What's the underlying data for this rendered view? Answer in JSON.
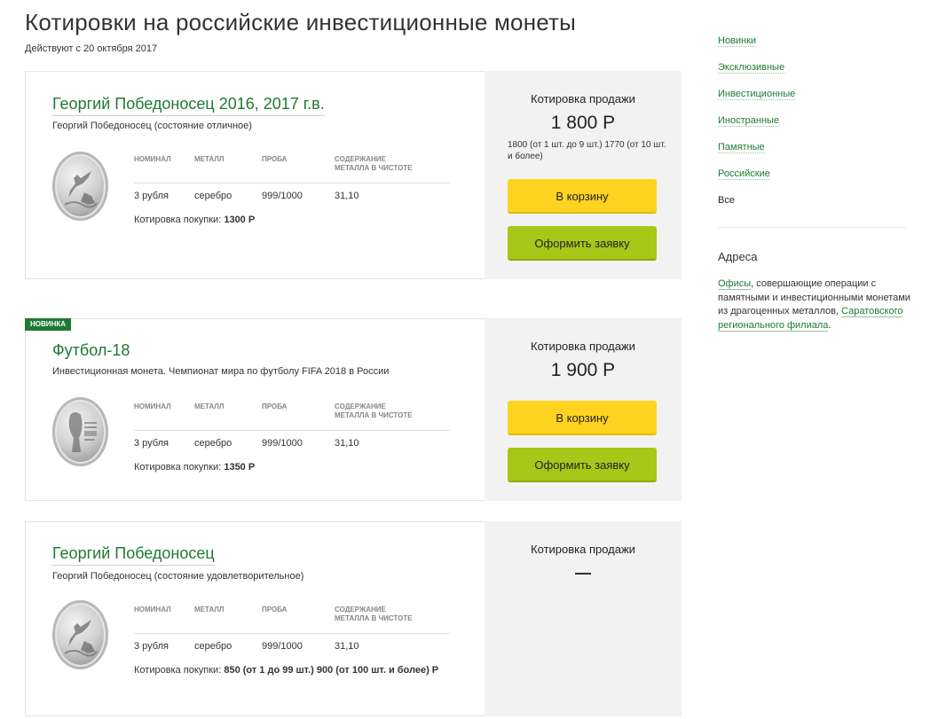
{
  "page": {
    "title": "Котировки на российские инвестиционные монеты",
    "subtitle": "Действуют с 20 октября 2017"
  },
  "table_headers": {
    "nominal": "НОМИНАЛ",
    "metal": "МЕТАЛЛ",
    "proba": "ПРОБА",
    "content_line1": "СОДЕРЖАНИЕ",
    "content_line2": "МЕТАЛЛА В ЧИСТОТЕ"
  },
  "labels": {
    "sale_quote": "Котировка продажи",
    "buy_quote": "Котировка покупки:",
    "cart_button": "В корзину",
    "order_button": "Оформить заявку",
    "badge_new": "НОВИНКА"
  },
  "coins": [
    {
      "title": "Георгий Победоносец 2016, 2017 г.в.",
      "description": "Георгий Победоносец (состояние отличное)",
      "nominal": "3 рубля",
      "metal": "серебро",
      "proba": "999/1000",
      "content": "31,10",
      "buy_price": "1300 Р",
      "sale_price": "1 800 Р",
      "sale_note": "1800 (от 1 шт. до 9 шт.) 1770 (от 10 шт. и более)"
    },
    {
      "title": "Футбол-18",
      "description": "Инвестиционная монета. Чемпионат мира по футболу FIFA 2018 в России",
      "nominal": "3 рубля",
      "metal": "серебро",
      "proba": "999/1000",
      "content": "31,10",
      "buy_price": "1350 Р",
      "sale_price": "1 900 Р"
    },
    {
      "title": "Георгий Победоносец",
      "description": "Георгий Победоносец (состояние удовлетворительное)",
      "nominal": "3 рубля",
      "metal": "серебро",
      "proba": "999/1000",
      "content": "31,10",
      "buy_price": "850 (от 1 до 99 шт.) 900 (от 100 шт. и более) Р",
      "sale_price": "—"
    }
  ],
  "sidebar": {
    "nav": [
      "Новинки",
      "Эксклюзивные",
      "Инвестиционные",
      "Иностранные",
      "Памятные",
      "Российские",
      "Все"
    ],
    "address_title": "Адреса",
    "address_link1": "Офисы",
    "address_text": ", совершающие операции с памятными и инвестиционными монетами из драгоценных металлов,",
    "address_link2": "Саратовского регионального филиала",
    "address_end": "."
  },
  "colors": {
    "accent_green": "#1e7a32",
    "cart_yellow": "#ffd31f",
    "order_green": "#a8c718",
    "panel_gray": "#f2f2f2"
  }
}
